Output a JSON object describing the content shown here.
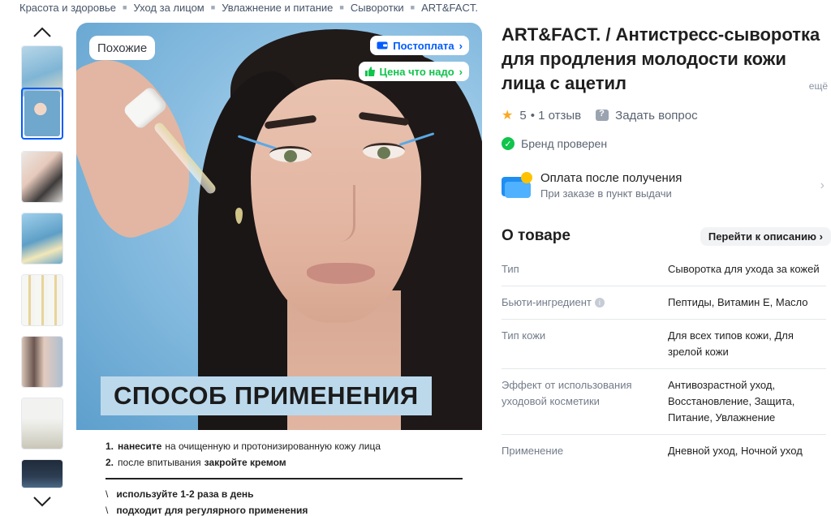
{
  "breadcrumb": [
    "Красота и здоровье",
    "Уход за лицом",
    "Увлажнение и питание",
    "Сыворотки",
    "ART&FACT."
  ],
  "gallery": {
    "badges": {
      "similar": "Похожие",
      "postpay": "Постоплата",
      "price": "Цена что надо"
    },
    "banner": "СПОСОБ ПРИМЕНЕНИЯ",
    "instructions": [
      {
        "num": "1.",
        "bold": "нанесите",
        "text": "на очищенную и протонизированную кожу лица"
      },
      {
        "num": "2.",
        "text": "после впитывания",
        "bold_end": "закройте кремом"
      }
    ],
    "tips": [
      "используйте 1-2 раза в день",
      "подходит для регулярного применения"
    ]
  },
  "product": {
    "title": "ART&FACT. / Антистресс-сыворотка для продления молодости кожи лица с ацетил",
    "more": "ещё",
    "rating": "5",
    "reviews": "• 1 отзыв",
    "ask": "Задать вопрос",
    "brand_check": "Бренд проверен",
    "payment": {
      "title": "Оплата после получения",
      "subtitle": "При заказе в пункт выдачи"
    },
    "about_title": "О товаре",
    "goto_description": "Перейти к описанию",
    "specs": [
      {
        "key": "Тип",
        "value": "Сыворотка для ухода за кожей"
      },
      {
        "key": "Бьюти-ингредиент",
        "value": "Пептиды, Витамин Е, Масло"
      },
      {
        "key": "Тип кожи",
        "value": "Для всех типов кожи, Для зрелой кожи"
      },
      {
        "key": "Эффект от использования уходовой косметики",
        "value": "Антивозрастной уход, Восстановление, Защита, Питание, Увлажнение"
      },
      {
        "key": "Применение",
        "value": "Дневной уход, Ночной уход"
      }
    ]
  },
  "colors": {
    "accent": "#005bff",
    "green": "#10c44c",
    "star": "#f9a825"
  }
}
